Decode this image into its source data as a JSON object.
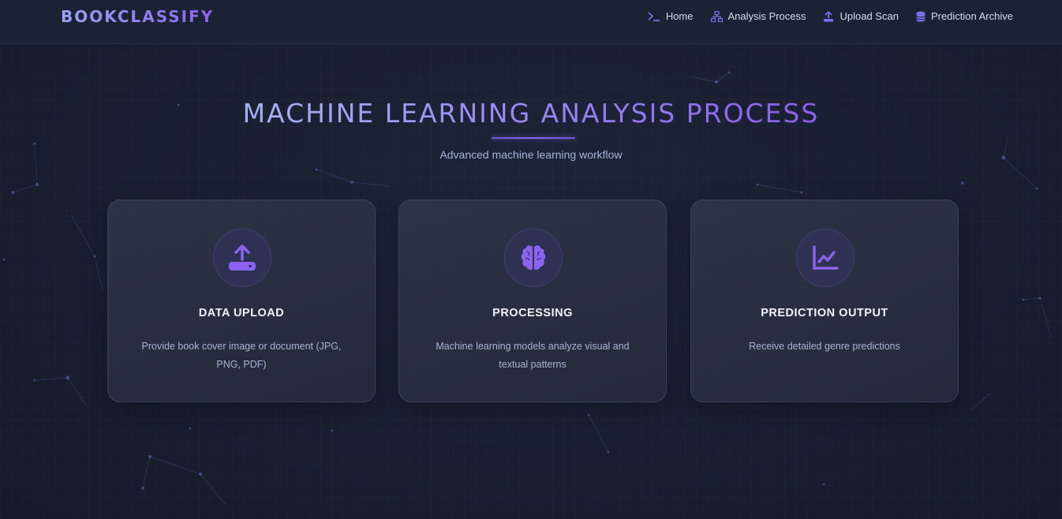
{
  "header": {
    "brand": "BOOKCLASSIFY",
    "nav": [
      {
        "label": "Home",
        "icon": "terminal-icon"
      },
      {
        "label": "Analysis Process",
        "icon": "sitemap-icon"
      },
      {
        "label": "Upload Scan",
        "icon": "upload-icon"
      },
      {
        "label": "Prediction Archive",
        "icon": "database-icon"
      }
    ]
  },
  "hero": {
    "title": "MACHINE LEARNING ANALYSIS PROCESS",
    "subtitle": "Advanced machine learning workflow"
  },
  "cards": [
    {
      "title": "DATA UPLOAD",
      "description": "Provide book cover image or document (JPG, PNG, PDF)",
      "icon": "upload-drive-icon"
    },
    {
      "title": "PROCESSING",
      "description": "Machine learning models analyze visual and textual patterns",
      "icon": "brain-icon"
    },
    {
      "title": "PREDICTION OUTPUT",
      "description": "Receive detailed genre predictions",
      "icon": "line-chart-icon"
    }
  ],
  "colors": {
    "background": "#182033",
    "accent": "#8b63f0",
    "accent_light": "#a8b2f8",
    "card_border": "#3a4358",
    "text_muted": "#a9b3d4"
  }
}
